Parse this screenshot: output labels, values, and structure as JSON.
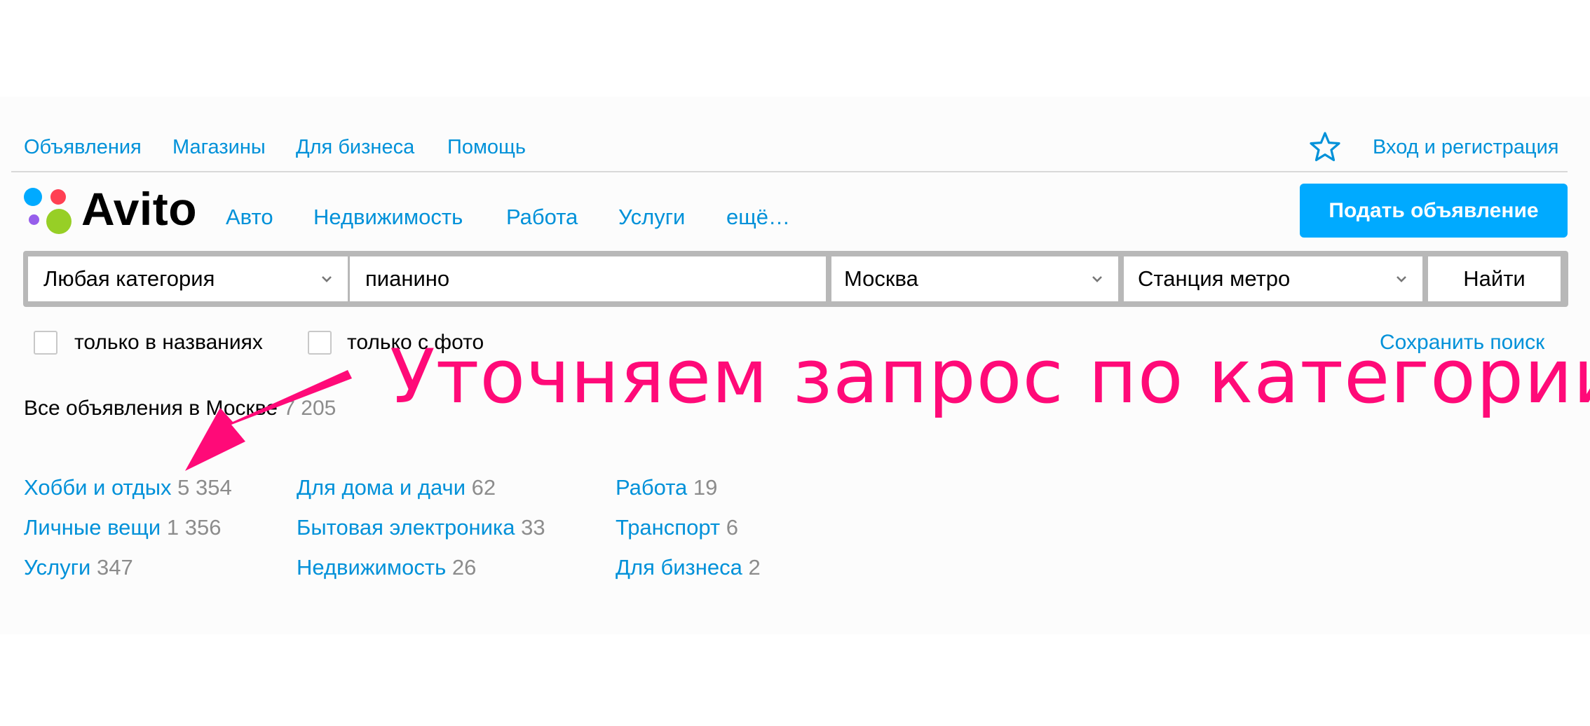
{
  "topnav": {
    "items": [
      "Объявления",
      "Магазины",
      "Для бизнеса",
      "Помощь"
    ],
    "login": "Вход и регистрация"
  },
  "logo": {
    "text": "Avito"
  },
  "categories": [
    "Авто",
    "Недвижимость",
    "Работа",
    "Услуги",
    "ещё…"
  ],
  "post_button": "Подать объявление",
  "search": {
    "category": "Любая категория",
    "query": "пианино",
    "city": "Москва",
    "metro": "Станция метро",
    "submit": "Найти"
  },
  "filters": {
    "titles_only": "только в названиях",
    "photo_only": "только с фото",
    "save_search": "Сохранить поиск"
  },
  "summary": {
    "label": "Все объявления в Москве",
    "count": "7 205"
  },
  "results": {
    "col1": [
      {
        "label": "Хобби и отдых",
        "count": "5 354"
      },
      {
        "label": "Личные вещи",
        "count": "1 356"
      },
      {
        "label": "Услуги",
        "count": "347"
      }
    ],
    "col2": [
      {
        "label": "Для дома и дачи",
        "count": "62"
      },
      {
        "label": "Бытовая электроника",
        "count": "33"
      },
      {
        "label": "Недвижимость",
        "count": "26"
      }
    ],
    "col3": [
      {
        "label": "Работа",
        "count": "19"
      },
      {
        "label": "Транспорт",
        "count": "6"
      },
      {
        "label": "Для бизнеса",
        "count": "2"
      }
    ]
  },
  "annotation": "Уточняем запрос по категории",
  "colors": {
    "link": "#0091d9",
    "accent_button": "#00aaff",
    "annotation": "#ff0a78"
  },
  "icons": [
    "star-icon",
    "chevron-down-icon",
    "checkbox-icon",
    "arrow-annotation"
  ]
}
